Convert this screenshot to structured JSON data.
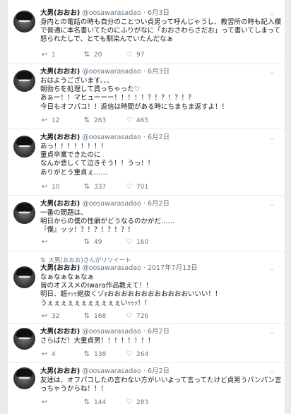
{
  "user": {
    "name": "大男(おおお)",
    "handle": "@oosawarasadao",
    "dot": "·"
  },
  "icons": {
    "reply": "reply-icon",
    "retweet": "retweet-icon",
    "like": "heart-icon",
    "more": "chevron-down-icon"
  },
  "tweets": [
    {
      "date": "6月3日",
      "lines": [
        "身内との電話の時も自分のことつい貞男って呼んじゃうし、教習所の時も記入欄",
        "で普通に本名書いてたのにふりがなに「おおさわらさだお」って書いてしまって",
        "怒られたしで、とても馴染んでいたんだなぁ"
      ],
      "reply": "1",
      "retweet": "20",
      "like": "97"
    },
    {
      "date": "6月3日",
      "lines": [
        "おはようございます、、、",
        "朝勃ちを処理して貰っちゃった♡",
        "あぁー！！マヒューーー！！！！！？！？！？！？",
        "今日もオフパコ！！返信は時間がある時にちまちま返すよ！！"
      ],
      "reply": "12",
      "retweet": "263",
      "like": "465"
    },
    {
      "date": "6月2日",
      "lines": [
        "あっ！！！！！！！！",
        "童貞卒業できたのに",
        "なんか悲しくて泣きそう！！うっ！！",
        "ありがとう童貞ぇ……"
      ],
      "reply": "10",
      "retweet": "337",
      "like": "701"
    },
    {
      "date": "6月2日",
      "lines": [
        "一番の問題は、",
        "明日からの僕の性癖がどうなるのかがだ……",
        "『僕』ッッ！？！？！？！？！"
      ],
      "reply": "",
      "retweet": "49",
      "like": "160"
    },
    {
      "context": "大男(おおお)さんがリツイート",
      "date": "2017年7月13日",
      "lines": [
        "なぁなぁなぁなぁ",
        "皆のオススメのIwara作品教えて！！",
        "明日、超ｯｯｯ絶抜くゾｫおおおおおおおおおおおおいいい！！",
        "うぇぇぇぇぇぇぇぇぇぇぇいｯｯｯ！！"
      ],
      "reply": "32",
      "retweet": "168",
      "like": "726"
    },
    {
      "date": "6月2日",
      "lines": [
        "さらばだ！大童貞男！！！！！！！！"
      ],
      "reply": "4",
      "retweet": "138",
      "like": "264"
    },
    {
      "date": "6月2日",
      "lines": [
        "友達は、オフパコしたの言わない方がいいよって言ってたけど貞男うパンパン言",
        "っちゃうからね！！！"
      ],
      "reply": "",
      "retweet": "144",
      "like": "283"
    }
  ]
}
